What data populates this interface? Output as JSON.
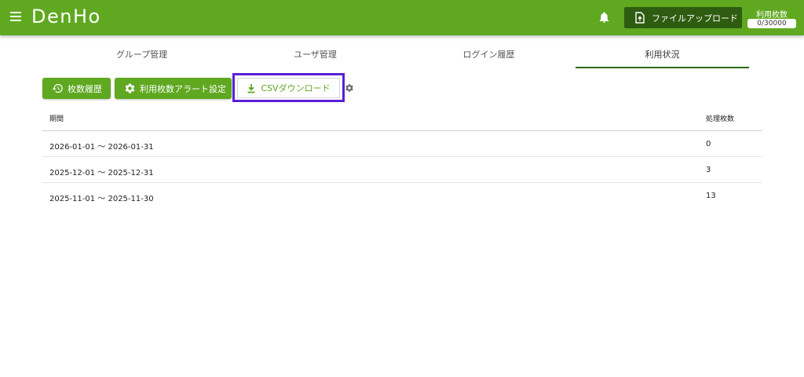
{
  "header": {
    "app_name": "DenHo",
    "upload_label": "ファイルアップロード",
    "usage_label": "利用枚数",
    "usage_count": "0/30000"
  },
  "tabs": [
    {
      "label": "グループ管理",
      "active": false
    },
    {
      "label": "ユーザ管理",
      "active": false
    },
    {
      "label": "ログイン履歴",
      "active": false
    },
    {
      "label": "利用状況",
      "active": true
    }
  ],
  "toolbar": {
    "history_label": "枚数履歴",
    "alert_label": "利用枚数アラート設定",
    "csv_label": "CSVダウンロード"
  },
  "table": {
    "headers": [
      "期間",
      "処理枚数"
    ],
    "rows": [
      {
        "period": "2026-01-01 〜 2026-01-31",
        "count": "0"
      },
      {
        "period": "2025-12-01 〜 2025-12-31",
        "count": "3"
      },
      {
        "period": "2025-11-01 〜 2025-11-30",
        "count": "13"
      }
    ]
  },
  "colors": {
    "primary": "#5fa820",
    "dark_green": "#2e5c10",
    "highlight": "#5b1fd6"
  },
  "icons": [
    "menu-icon",
    "bell-icon",
    "file-upload-icon",
    "history-icon",
    "gear-icon",
    "download-icon",
    "settings-icon"
  ]
}
